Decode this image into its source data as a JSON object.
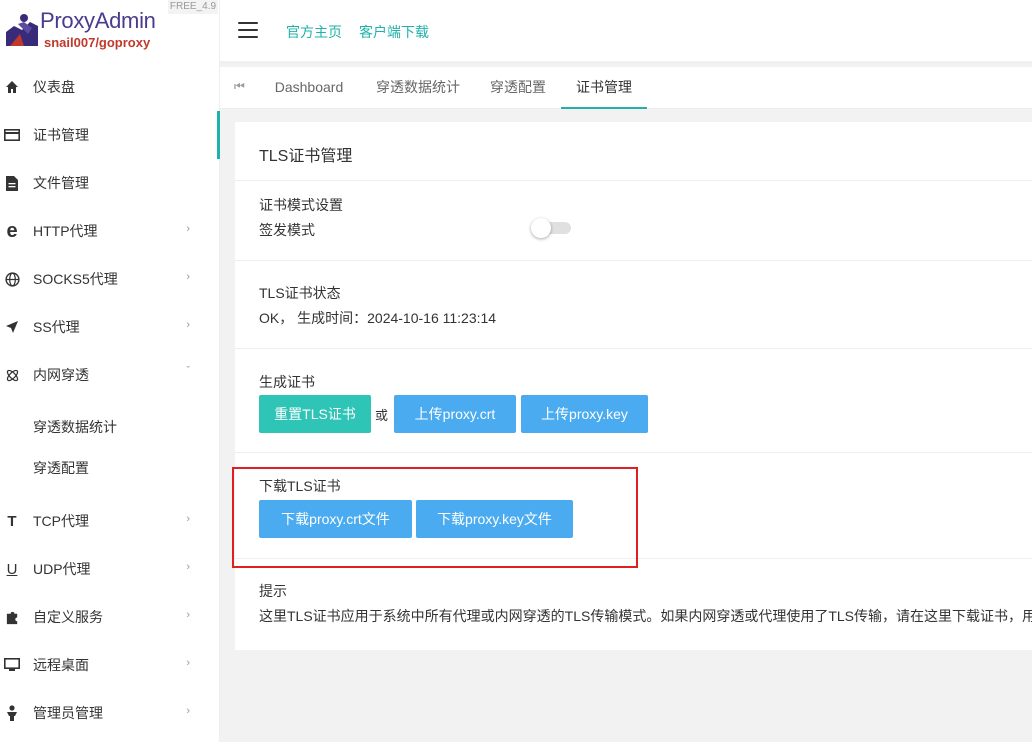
{
  "app": {
    "title": "ProxyAdmin",
    "subtitle": "snail007/goproxy",
    "version": "FREE_4.9"
  },
  "sidebar": {
    "items": [
      {
        "label": "仪表盘",
        "icon": "home-icon"
      },
      {
        "label": "证书管理",
        "icon": "card-icon"
      },
      {
        "label": "文件管理",
        "icon": "file-icon"
      },
      {
        "label": "HTTP代理",
        "icon": "edge-icon"
      },
      {
        "label": "SOCKS5代理",
        "icon": "globe-icon"
      },
      {
        "label": "SS代理",
        "icon": "send-icon"
      },
      {
        "label": "内网穿透",
        "icon": "atom-icon"
      },
      {
        "label": "TCP代理",
        "icon": "text-t-icon"
      },
      {
        "label": "UDP代理",
        "icon": "underline-icon"
      },
      {
        "label": "自定义服务",
        "icon": "puzzle-icon"
      },
      {
        "label": "远程桌面",
        "icon": "desktop-icon"
      },
      {
        "label": "管理员管理",
        "icon": "person-icon"
      }
    ],
    "subitems": [
      {
        "label": "穿透数据统计"
      },
      {
        "label": "穿透配置"
      }
    ],
    "active": "证书管理"
  },
  "header": {
    "links": [
      "官方主页",
      "客户端下载"
    ]
  },
  "tabs": {
    "items": [
      "Dashboard",
      "穿透数据统计",
      "穿透配置",
      "证书管理"
    ],
    "active": "证书管理"
  },
  "card": {
    "title": "TLS证书管理",
    "mode": {
      "label": "证书模式设置",
      "option_label": "签发模式",
      "enabled": false
    },
    "status": {
      "label": "TLS证书状态",
      "text": "OK， 生成时间：2024-10-16 11:23:14"
    },
    "generate": {
      "label": "生成证书",
      "reset_button": "重置TLS证书",
      "or_text": "或",
      "upload_crt_button": "上传proxy.crt",
      "upload_key_button": "上传proxy.key"
    },
    "download": {
      "label": "下载TLS证书",
      "crt_button": "下载proxy.crt文件",
      "key_button": "下载proxy.key文件"
    },
    "tip": {
      "label": "提示",
      "text": "这里TLS证书应用于系统中所有代理或内网穿透的TLS传输模式。如果内网穿透或代理使用了TLS传输，请在这里下载证书，用于"
    }
  },
  "colors": {
    "accent": "#20b2aa",
    "teal_button": "#2ec4b6",
    "blue_button": "#4aabf0",
    "highlight": "#e02020"
  }
}
